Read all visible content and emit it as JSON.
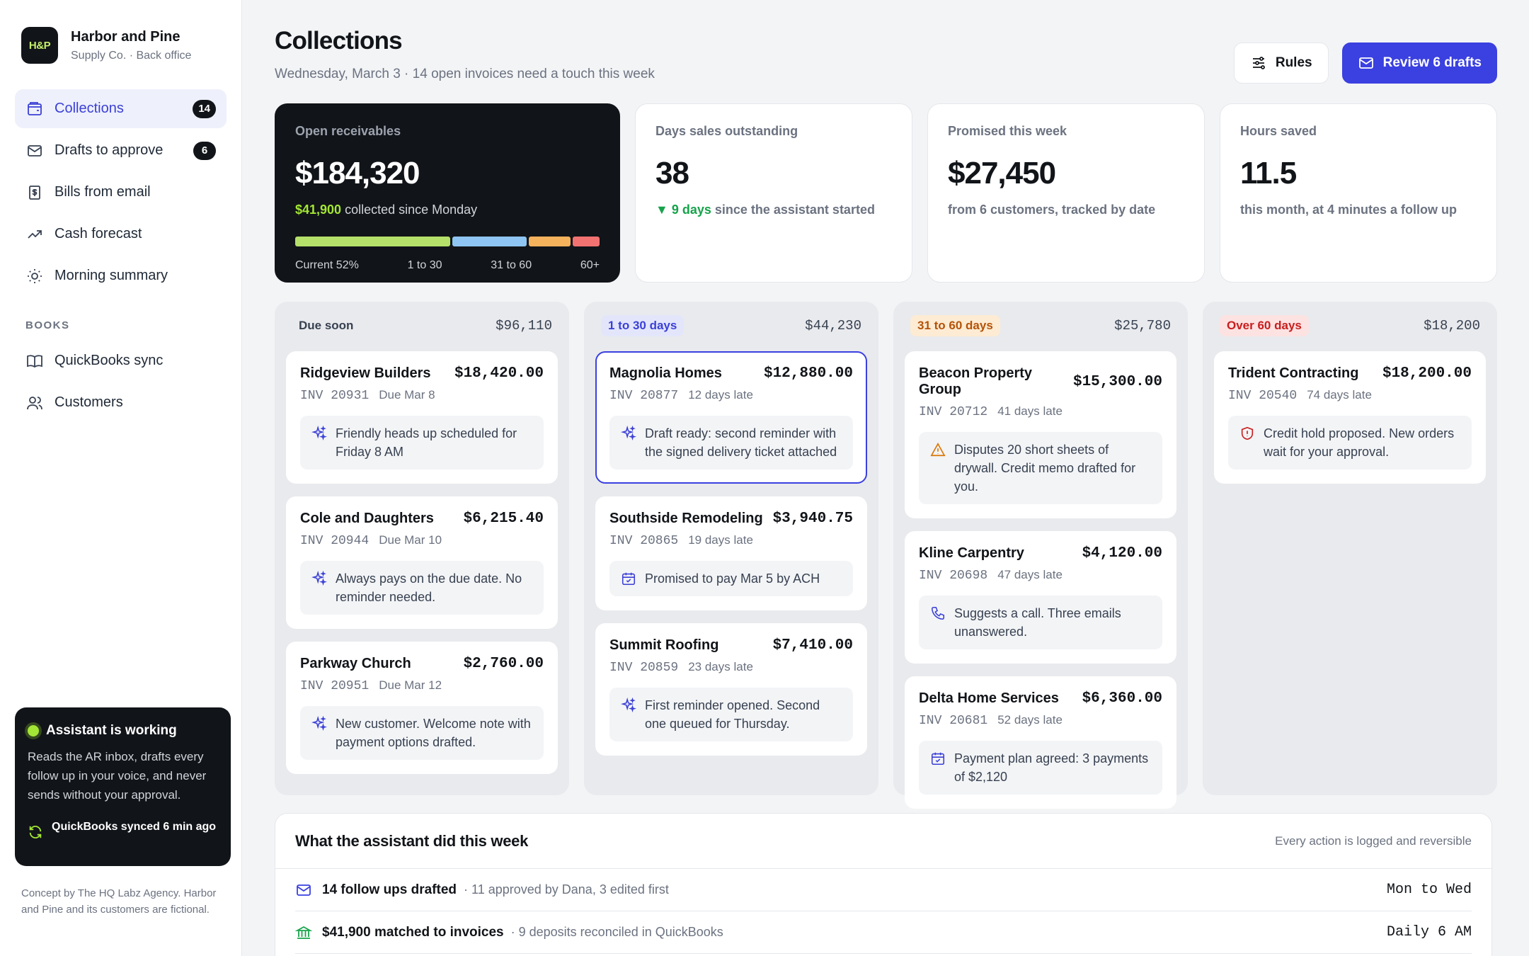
{
  "brand": {
    "logo_text": "H&P",
    "name": "Harbor and Pine",
    "sub": "Supply Co. · Back office"
  },
  "nav": {
    "items": [
      {
        "label": "Collections",
        "badge": "14"
      },
      {
        "label": "Drafts to approve",
        "badge": "6"
      },
      {
        "label": "Bills from email"
      },
      {
        "label": "Cash forecast"
      },
      {
        "label": "Morning summary"
      }
    ],
    "section_books": "BOOKS",
    "books_items": [
      {
        "label": "QuickBooks sync"
      },
      {
        "label": "Customers"
      }
    ]
  },
  "assistant": {
    "title": "Assistant is working",
    "desc": "Reads the AR inbox, drafts every follow up in your voice, and never sends without your approval.",
    "sync": "QuickBooks synced 6 min ago"
  },
  "concept": "Concept by The HQ Labz Agency. Harbor and Pine and its customers are fictional.",
  "header": {
    "title": "Collections",
    "sub": "Wednesday, March 3 · 14 open invoices need a touch this week",
    "rules_label": "Rules",
    "review_label": "Review 6 drafts"
  },
  "stats": {
    "open": {
      "label": "Open receivables",
      "value": "$184,320",
      "hl": "$41,900",
      "note": " collected since Monday",
      "aging": [
        {
          "label": "Current 52%",
          "share": 52,
          "color": "#b5e06a"
        },
        {
          "label": "1 to 30",
          "share": 25,
          "color": "#8ec5f2"
        },
        {
          "label": "31 to 60",
          "share": 14,
          "color": "#f5b25c"
        },
        {
          "label": "60+",
          "share": 9,
          "color": "#f27272"
        }
      ]
    },
    "dso": {
      "label": "Days sales outstanding",
      "value": "38",
      "hl": "▼ 9 days",
      "note": " since the assistant started"
    },
    "promised": {
      "label": "Promised this week",
      "value": "$27,450",
      "note": "from 6 customers, tracked by date"
    },
    "hours": {
      "label": "Hours saved",
      "value": "11.5",
      "note": "this month, at 4 minutes a follow up"
    }
  },
  "columns": [
    {
      "tag": "Due soon",
      "tag_bg": "transparent",
      "tag_color": "#374151",
      "total": "$96,110",
      "cards": [
        {
          "name": "Ridgeview Builders",
          "amount": "$18,420.00",
          "inv": "INV 20931",
          "status": "Due Mar 8",
          "icon": "sparkle-icon",
          "note": "Friendly heads up scheduled for Friday 8 AM"
        },
        {
          "name": "Cole and Daughters",
          "amount": "$6,215.40",
          "inv": "INV 20944",
          "status": "Due Mar 10",
          "icon": "sparkle-icon",
          "note": "Always pays on the due date. No reminder needed."
        },
        {
          "name": "Parkway Church",
          "amount": "$2,760.00",
          "inv": "INV 20951",
          "status": "Due Mar 12",
          "icon": "sparkle-icon",
          "note": "New customer. Welcome note with payment options drafted."
        }
      ]
    },
    {
      "tag": "1 to 30 days",
      "tag_bg": "#e3e6fb",
      "tag_color": "#3b40d6",
      "total": "$44,230",
      "cards": [
        {
          "name": "Magnolia Homes",
          "amount": "$12,880.00",
          "inv": "INV 20877",
          "status": "12 days late",
          "icon": "sparkle-icon",
          "note": "Draft ready: second reminder with the signed delivery ticket attached",
          "selected": true
        },
        {
          "name": "Southside Remodeling",
          "amount": "$3,940.75",
          "inv": "INV 20865",
          "status": "19 days late",
          "icon": "calendar-icon",
          "note": "Promised to pay Mar 5 by ACH"
        },
        {
          "name": "Summit Roofing",
          "amount": "$7,410.00",
          "inv": "INV 20859",
          "status": "23 days late",
          "icon": "sparkle-icon",
          "note": "First reminder opened. Second one queued for Thursday."
        }
      ]
    },
    {
      "tag": "31 to 60 days",
      "tag_bg": "#fdebd3",
      "tag_color": "#b45309",
      "total": "$25,780",
      "cards": [
        {
          "name": "Beacon Property Group",
          "amount": "$15,300.00",
          "inv": "INV 20712",
          "status": "41 days late",
          "icon": "warning-icon",
          "note": "Disputes 20 short sheets of drywall. Credit memo drafted for you."
        },
        {
          "name": "Kline Carpentry",
          "amount": "$4,120.00",
          "inv": "INV 20698",
          "status": "47 days late",
          "icon": "phone-icon",
          "note": "Suggests a call. Three emails unanswered."
        },
        {
          "name": "Delta Home Services",
          "amount": "$6,360.00",
          "inv": "INV 20681",
          "status": "52 days late",
          "icon": "calendar-icon",
          "note": "Payment plan agreed: 3 payments of $2,120"
        }
      ]
    },
    {
      "tag": "Over 60 days",
      "tag_bg": "#fde2e2",
      "tag_color": "#c81e1e",
      "total": "$18,200",
      "cards": [
        {
          "name": "Trident Contracting",
          "amount": "$18,200.00",
          "inv": "INV 20540",
          "status": "74 days late",
          "icon": "shield-icon",
          "note": "Credit hold proposed. New orders wait for your approval."
        }
      ]
    }
  ],
  "activity": {
    "title": "What the assistant did this week",
    "sub": "Every action is logged and reversible",
    "rows": [
      {
        "icon": "mail-icon",
        "main": "14 follow ups drafted",
        "detail": "· 11 approved by Dana, 3 edited first",
        "time": "Mon to Wed"
      },
      {
        "icon": "bank-icon",
        "main": "$41,900 matched to invoices",
        "detail": "· 9 deposits reconciled in QuickBooks",
        "time": "Daily 6 AM"
      }
    ]
  },
  "colors": {
    "accent": "#3b40e0",
    "dark": "#111418"
  }
}
